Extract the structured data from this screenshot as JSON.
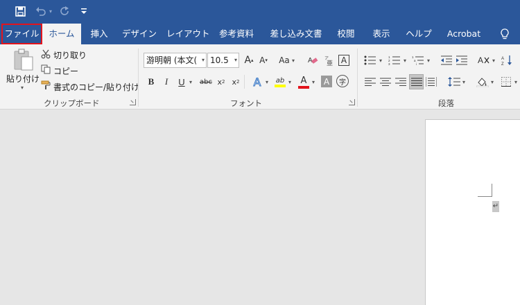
{
  "quick_access": {
    "save_icon": "save-icon",
    "undo_icon": "undo-icon",
    "redo_icon": "redo-icon",
    "customize_icon": "customize-qat-icon"
  },
  "tabs": [
    {
      "label": "ファイル"
    },
    {
      "label": "ホーム"
    },
    {
      "label": "挿入"
    },
    {
      "label": "デザイン"
    },
    {
      "label": "レイアウト"
    },
    {
      "label": "参考資料"
    },
    {
      "label": "差し込み文書"
    },
    {
      "label": "校閲"
    },
    {
      "label": "表示"
    },
    {
      "label": "ヘルプ"
    },
    {
      "label": "Acrobat"
    }
  ],
  "tell_me_icon": "lightbulb-icon",
  "clipboard": {
    "paste_label": "貼り付け",
    "cut_label": "切り取り",
    "copy_label": "コピー",
    "format_painter_label": "書式のコピー/貼り付け",
    "group_label": "クリップボード"
  },
  "font": {
    "font_name": "游明朝 (本文(",
    "font_size": "10.5",
    "grow_label": "A",
    "shrink_label": "A",
    "case_label": "Aa",
    "bold_label": "B",
    "italic_label": "I",
    "underline_label": "U",
    "strike_label": "abc",
    "subscript_label": "x",
    "superscript_label": "x",
    "sub_mark": "2",
    "sup_mark": "2",
    "text_effects_label": "A",
    "highlight_label": "ab",
    "font_color_label": "A",
    "char_shading_label": "A",
    "char_border_label": "A",
    "enclose_label": "字",
    "group_label": "フォント",
    "font_color_bar": "#e3141c",
    "highlight_bar": "#ffff00"
  },
  "paragraph": {
    "group_label": "段落"
  },
  "colors": {
    "brand": "#2b579a",
    "file_highlight": "#e3141c",
    "ribbon_bg": "#f3f3f3",
    "canvas_bg": "#e6e6e6"
  }
}
